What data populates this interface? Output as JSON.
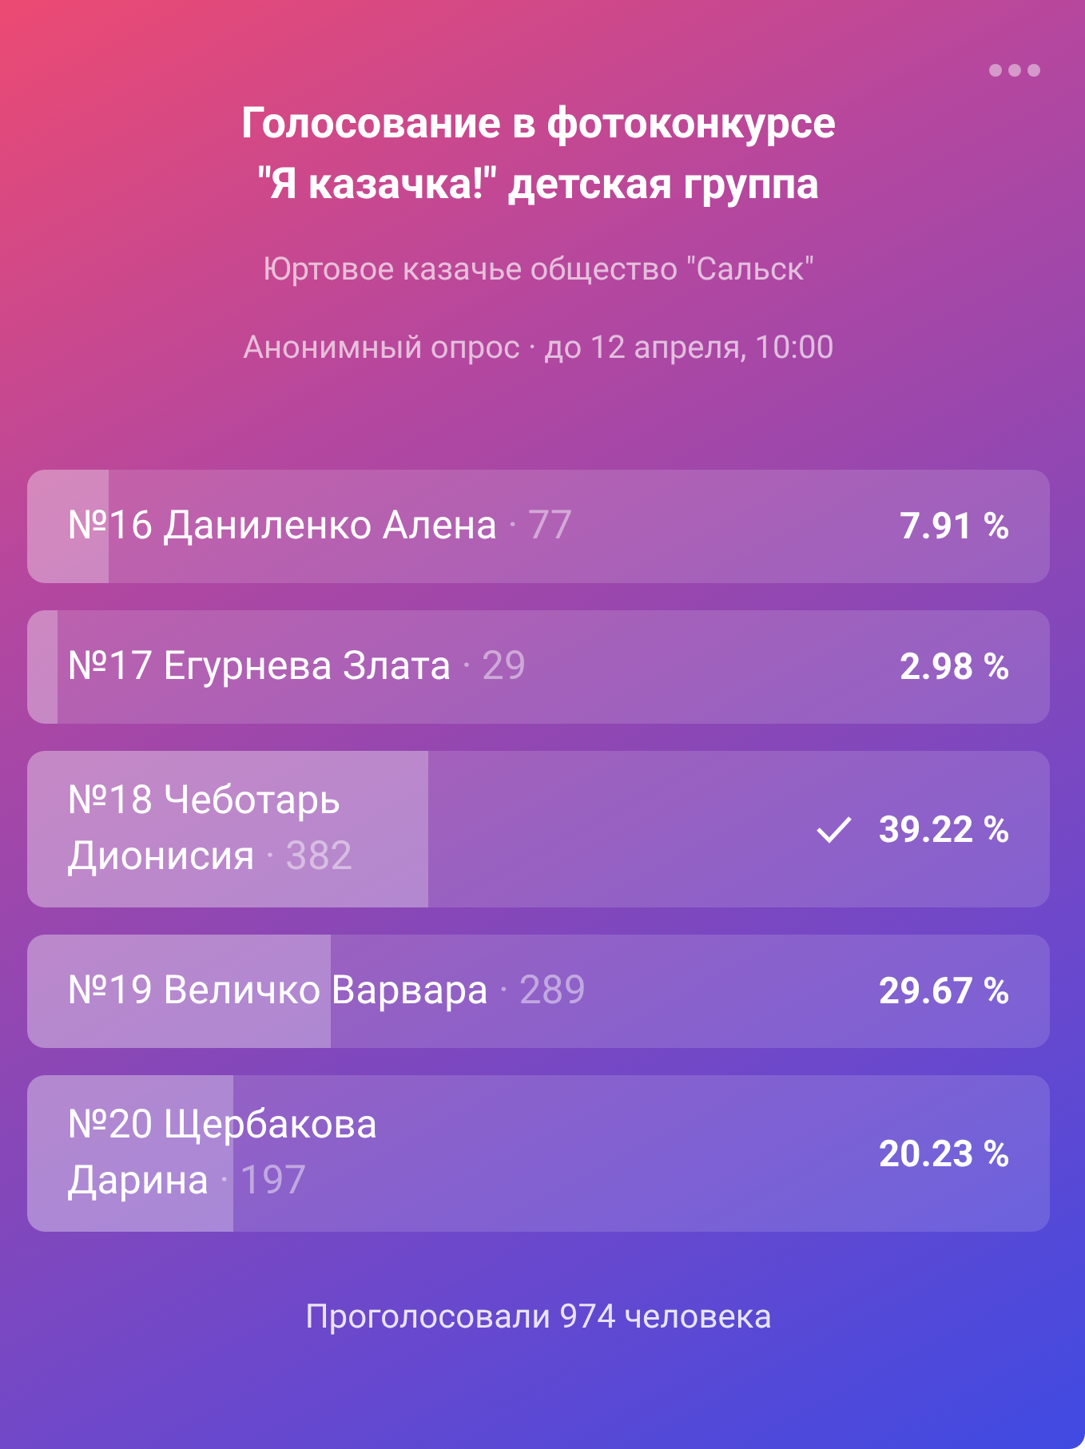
{
  "poll": {
    "title": "Голосование в фотоконкурсе\n\"Я казачка!\" детская группа",
    "author": "Юртовое казачье общество \"Сальск\"",
    "meta": "Анонимный опрос · до 12 апреля, 10:00"
  },
  "options": [
    {
      "name": "№16 Даниленко Алена",
      "votes": "· 77",
      "percent": "7.91 %",
      "level": 0.0791,
      "selected": false
    },
    {
      "name": "№17 Егурнева Злата",
      "votes": "· 29",
      "percent": "2.98 %",
      "level": 0.0298,
      "selected": false
    },
    {
      "name": "№18 Чеботарь\nДионисия",
      "votes": "· 382",
      "percent": "39.22 %",
      "level": 0.3922,
      "selected": true
    },
    {
      "name": "№19 Величко Варвара",
      "votes": "· 289",
      "percent": "29.67 %",
      "level": 0.2967,
      "selected": false
    },
    {
      "name": "№20 Щербакова\nДарина",
      "votes": "· 197",
      "percent": "20.23 %",
      "level": 0.2023,
      "selected": false
    }
  ],
  "footer": "Проголосовали 974 человека"
}
